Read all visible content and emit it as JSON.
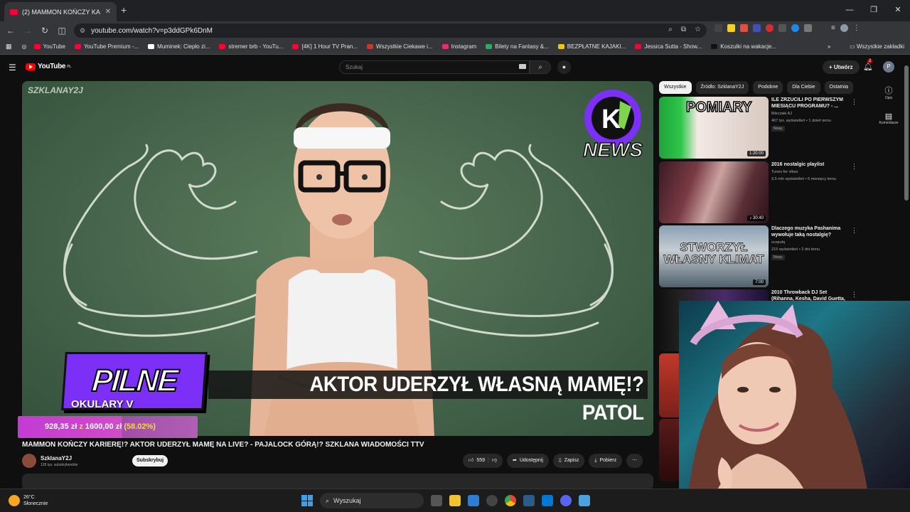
{
  "browser": {
    "tab_title": "(2) MAMMON KOŃCZY KA",
    "url": "youtube.com/watch?v=p3ddGPk6DnM",
    "bookmarks": [
      {
        "label": "YouTube",
        "color": "#ff0033"
      },
      {
        "label": "YouTube Premium -...",
        "color": "#ff0033"
      },
      {
        "label": "Muminek: Ciepło zi...",
        "color": "#ffffff"
      },
      {
        "label": "stremer brb - YouTu...",
        "color": "#ff0033"
      },
      {
        "label": "[4K] 1 Hour TV Pran...",
        "color": "#ff0033"
      },
      {
        "label": "Wszystkie Ciekawe i...",
        "color": "#c0392b"
      },
      {
        "label": "Instagram",
        "color": "#e1306c"
      },
      {
        "label": "Bilety na Fantasy &...",
        "color": "#27ae60"
      },
      {
        "label": "BEZPŁATNE KAJAKI...",
        "color": "#f1c40f"
      },
      {
        "label": "Jessica Sutta - Show...",
        "color": "#ff0033"
      },
      {
        "label": "Koszulki na wakacje...",
        "color": "#111111"
      }
    ],
    "all_bookmarks": "Wszystkie zakładki"
  },
  "youtube": {
    "logo": "YouTube",
    "logo_region": "PL",
    "search_placeholder": "Szukaj",
    "create_label": "Utwórz",
    "notif_count": "2",
    "avatar_letter": "P",
    "video": {
      "channel_watermark": "SZKLANAY2J",
      "overlay_tag": "PILNE",
      "overlay_banner": "AKTOR UDERZYŁ WŁASNĄ MAMĘ!? PATOL",
      "news_badge": "NEWS",
      "title": "MAMMON KOŃCZY KARIERĘ!? AKTOR UDERZYŁ MAMĘ NA LIVE? - PAJALOCK GÓRĄ!? SZKLANA WIADOMOŚCI TTV",
      "channel": "SzklanaY2J",
      "subscribers": "128 tys. subskrybentów",
      "subscribe": "Subskrybuj",
      "likes": "559",
      "share": "Udostępnij",
      "save": "Zapisz",
      "download": "Pobierz"
    },
    "chips": [
      "Wszystkie",
      "Źródło: SzklanaY2J",
      "Podobne",
      "Dla Ciebie",
      "Ostatnio"
    ],
    "recommendations": [
      {
        "title": "ILE ZRZUCILI PO PIERWSZYM MIESIĄCU PROGRAMU? - ...",
        "channel": "Mieczaki AJ",
        "meta": "467 tys. wyświetleń • 1 dzień temu",
        "badge": "Nowy",
        "duration": "1:20:00",
        "thumb_text": "POMIARY"
      },
      {
        "title": "2016 nostalgic playlist",
        "channel": "Tunes for vibes",
        "meta": "3,5 mln wyświetleń • 6 miesięcy temu",
        "badge": "",
        "duration": "♪ 30:40",
        "thumb_text": ""
      },
      {
        "title": "Dlaczego muzyka Pashanima wywołuje taką nostalgię?",
        "channel": "scopulq",
        "meta": "215 wyświetleń • 2 dni temu",
        "badge": "Nowy",
        "duration": "7:00",
        "thumb_text": "STWORZYŁ WŁASNY KLIMAT"
      },
      {
        "title": "2010 Throwback DJ Set (Rihanna, Kesha, David Guetta, Taio Cruz, ...",
        "channel": "",
        "meta": "",
        "badge": "",
        "duration": "",
        "thumb_text": ""
      }
    ],
    "siderail": [
      {
        "icon": "ⓘ",
        "label": "Opis"
      },
      {
        "icon": "▤",
        "label": "Komentarze"
      }
    ]
  },
  "stream_overlay": {
    "okulary": "OKULARY V",
    "donation_current": "928,35 zł",
    "donation_sep": "z",
    "donation_goal": "1600,00 zł",
    "donation_pct": "(58.02%)",
    "progress": 0.5802
  },
  "taskbar": {
    "temp": "26°C",
    "weather": "Słonecznie",
    "search": "Wyszukaj"
  }
}
